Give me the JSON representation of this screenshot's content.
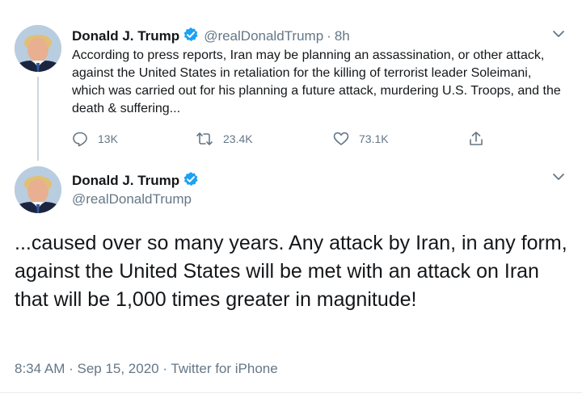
{
  "tweet1": {
    "name": "Donald J. Trump",
    "handle": "@realDonaldTrump",
    "separator": "·",
    "time": "8h",
    "text": "According to press reports, Iran may be planning an assassination, or other attack, against the United States in retaliation for the killing of terrorist leader Soleimani, which was carried out for his planning a future attack, murdering U.S. Troops, and the death & suffering...",
    "actions": {
      "replies": "13K",
      "retweets": "23.4K",
      "likes": "73.1K"
    }
  },
  "tweet2": {
    "name": "Donald J. Trump",
    "handle": "@realDonaldTrump",
    "text": "...caused over so many years. Any attack by Iran, in any form, against the United States will be met with an attack on Iran that will be 1,000 times greater in magnitude!",
    "meta": "8:34 AM · Sep 15, 2020 · Twitter for iPhone"
  },
  "icons": {
    "verified": "verified-badge-icon",
    "reply": "reply-icon",
    "retweet": "retweet-icon",
    "like": "heart-icon",
    "share": "share-icon",
    "more": "chevron-down-icon"
  },
  "colors": {
    "verified_blue": "#1da1f2",
    "secondary_text": "#657786",
    "primary_text": "#14171a",
    "thread_line": "#ccd6dd"
  }
}
